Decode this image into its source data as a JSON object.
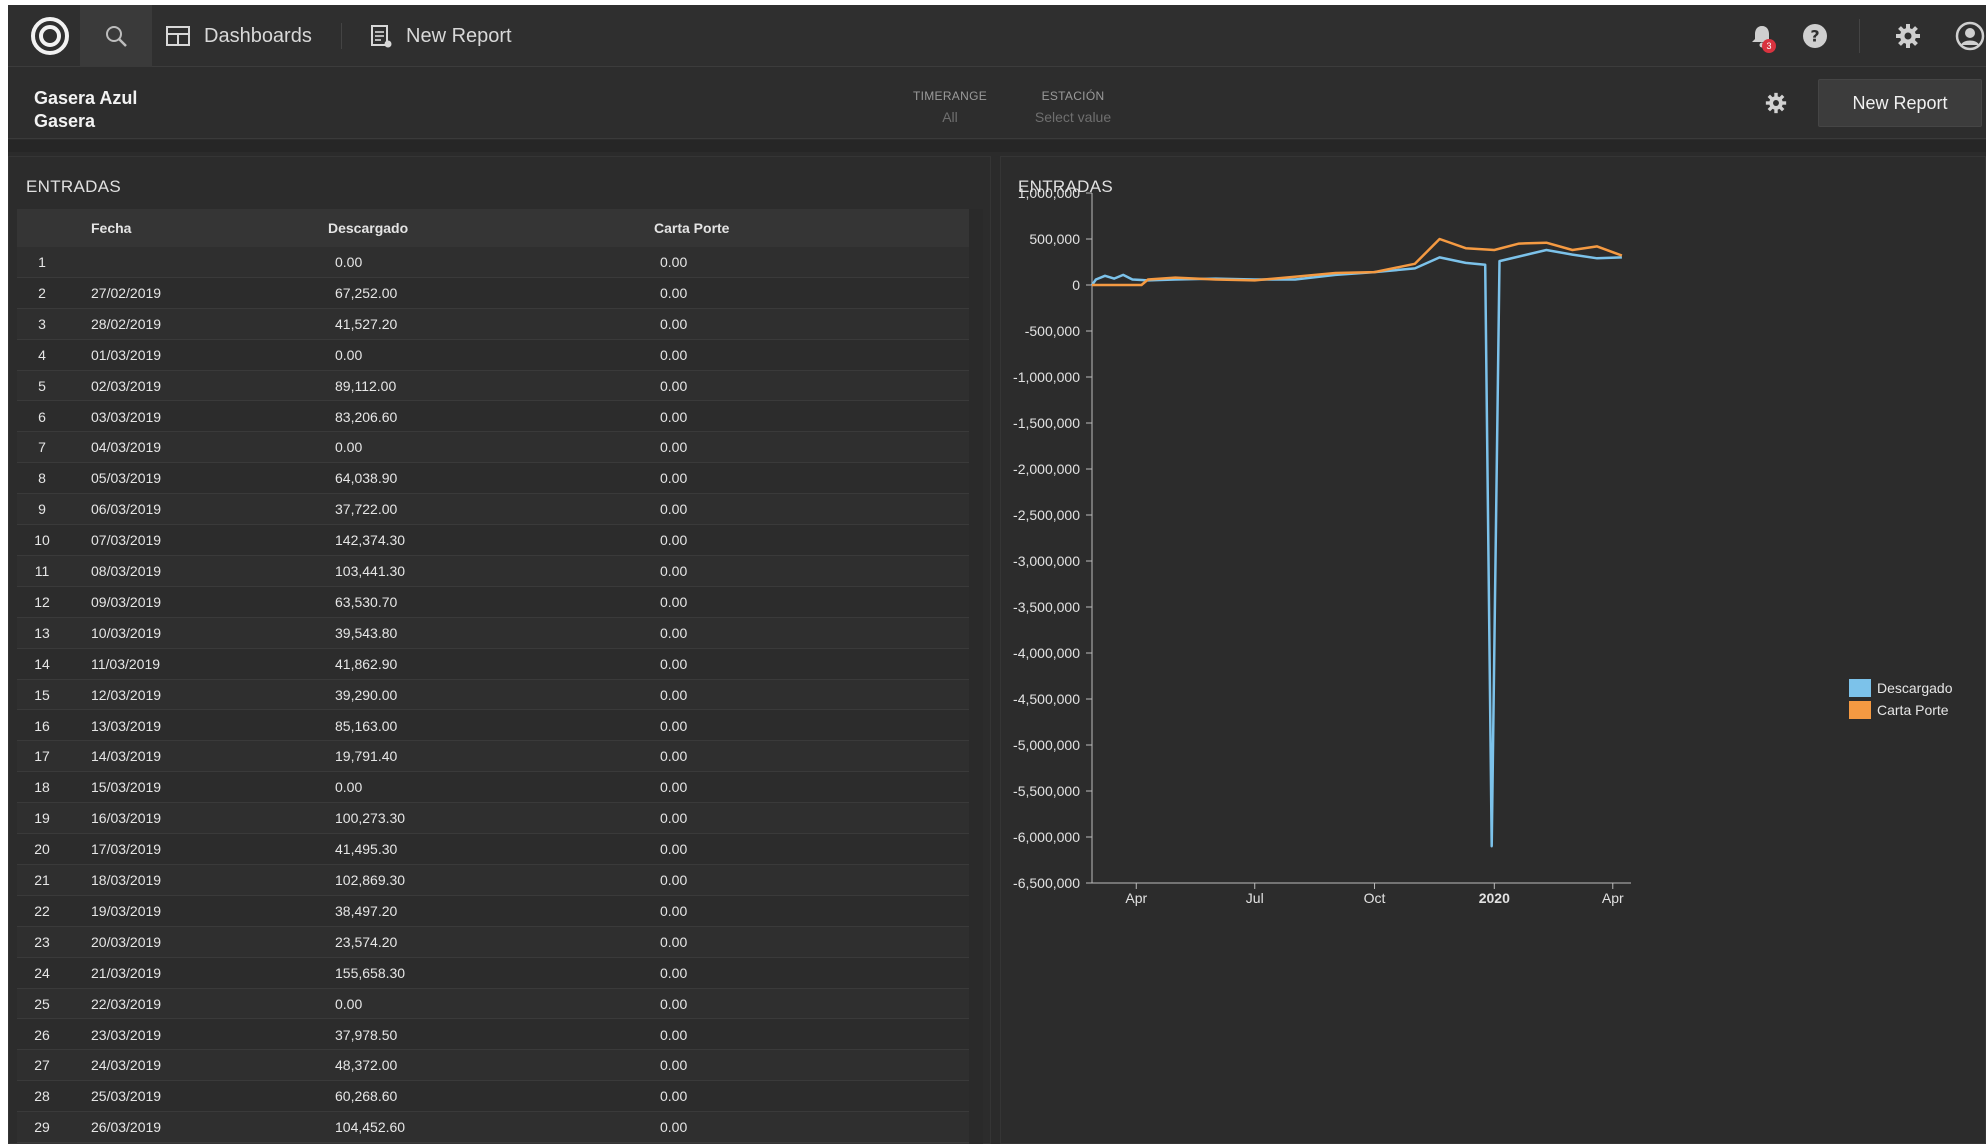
{
  "nav": {
    "dashboards_label": "Dashboards",
    "new_report_label": "New Report",
    "notification_count": "3"
  },
  "dashboard": {
    "title_line1": "Gasera Azul",
    "title_line2": "Gasera",
    "filters": {
      "timerange": {
        "label": "TIMERANGE",
        "value": "All"
      },
      "estacion": {
        "label": "ESTACIÓN",
        "value": "Select value"
      }
    },
    "new_report_button": "New Report"
  },
  "table_panel": {
    "title": "ENTRADAS",
    "columns": [
      "Fecha",
      "Descargado",
      "Carta Porte"
    ],
    "rows": [
      [
        "1",
        "",
        "0.00",
        "0.00"
      ],
      [
        "2",
        "27/02/2019",
        "67,252.00",
        "0.00"
      ],
      [
        "3",
        "28/02/2019",
        "41,527.20",
        "0.00"
      ],
      [
        "4",
        "01/03/2019",
        "0.00",
        "0.00"
      ],
      [
        "5",
        "02/03/2019",
        "89,112.00",
        "0.00"
      ],
      [
        "6",
        "03/03/2019",
        "83,206.60",
        "0.00"
      ],
      [
        "7",
        "04/03/2019",
        "0.00",
        "0.00"
      ],
      [
        "8",
        "05/03/2019",
        "64,038.90",
        "0.00"
      ],
      [
        "9",
        "06/03/2019",
        "37,722.00",
        "0.00"
      ],
      [
        "10",
        "07/03/2019",
        "142,374.30",
        "0.00"
      ],
      [
        "11",
        "08/03/2019",
        "103,441.30",
        "0.00"
      ],
      [
        "12",
        "09/03/2019",
        "63,530.70",
        "0.00"
      ],
      [
        "13",
        "10/03/2019",
        "39,543.80",
        "0.00"
      ],
      [
        "14",
        "11/03/2019",
        "41,862.90",
        "0.00"
      ],
      [
        "15",
        "12/03/2019",
        "39,290.00",
        "0.00"
      ],
      [
        "16",
        "13/03/2019",
        "85,163.00",
        "0.00"
      ],
      [
        "17",
        "14/03/2019",
        "19,791.40",
        "0.00"
      ],
      [
        "18",
        "15/03/2019",
        "0.00",
        "0.00"
      ],
      [
        "19",
        "16/03/2019",
        "100,273.30",
        "0.00"
      ],
      [
        "20",
        "17/03/2019",
        "41,495.30",
        "0.00"
      ],
      [
        "21",
        "18/03/2019",
        "102,869.30",
        "0.00"
      ],
      [
        "22",
        "19/03/2019",
        "38,497.20",
        "0.00"
      ],
      [
        "23",
        "20/03/2019",
        "23,574.20",
        "0.00"
      ],
      [
        "24",
        "21/03/2019",
        "155,658.30",
        "0.00"
      ],
      [
        "25",
        "22/03/2019",
        "0.00",
        "0.00"
      ],
      [
        "26",
        "23/03/2019",
        "37,978.50",
        "0.00"
      ],
      [
        "27",
        "24/03/2019",
        "48,372.00",
        "0.00"
      ],
      [
        "28",
        "25/03/2019",
        "60,268.60",
        "0.00"
      ],
      [
        "29",
        "26/03/2019",
        "104,452.60",
        "0.00"
      ]
    ]
  },
  "chart_panel": {
    "title": "ENTRADAS"
  },
  "chart_data": {
    "type": "line",
    "title": "ENTRADAS",
    "ylim": [
      -6500000,
      1000000
    ],
    "y_ticks": [
      "1,000,000",
      "500,000",
      "0",
      "-500,000",
      "-1,000,000",
      "-1,500,000",
      "-2,000,000",
      "-2,500,000",
      "-3,000,000",
      "-3,500,000",
      "-4,000,000",
      "-4,500,000",
      "-5,000,000",
      "-5,500,000",
      "-6,000,000",
      "-6,500,000"
    ],
    "x_ticks": [
      {
        "label": "Apr",
        "date": "2019-04-01"
      },
      {
        "label": "Jul",
        "date": "2019-07-01"
      },
      {
        "label": "Oct",
        "date": "2019-10-01"
      },
      {
        "label": "2020",
        "date": "2020-01-01"
      },
      {
        "label": "Apr",
        "date": "2020-04-01"
      }
    ],
    "xlim": [
      "2019-02-26",
      "2020-04-15"
    ],
    "legend_position": "right",
    "series": [
      {
        "name": "Descargado",
        "color": "#7cc2ea",
        "points": [
          [
            "2019-02-26",
            0
          ],
          [
            "2019-03-01",
            60000
          ],
          [
            "2019-03-08",
            100000
          ],
          [
            "2019-03-15",
            70000
          ],
          [
            "2019-03-22",
            110000
          ],
          [
            "2019-03-29",
            60000
          ],
          [
            "2019-04-10",
            50000
          ],
          [
            "2019-05-01",
            60000
          ],
          [
            "2019-06-01",
            70000
          ],
          [
            "2019-07-01",
            60000
          ],
          [
            "2019-08-01",
            60000
          ],
          [
            "2019-09-01",
            110000
          ],
          [
            "2019-10-01",
            140000
          ],
          [
            "2019-11-01",
            180000
          ],
          [
            "2019-11-20",
            300000
          ],
          [
            "2019-12-10",
            240000
          ],
          [
            "2019-12-25",
            220000
          ],
          [
            "2019-12-30",
            -6100000
          ],
          [
            "2020-01-05",
            260000
          ],
          [
            "2020-01-20",
            310000
          ],
          [
            "2020-02-10",
            380000
          ],
          [
            "2020-03-01",
            330000
          ],
          [
            "2020-03-20",
            290000
          ],
          [
            "2020-04-08",
            300000
          ]
        ]
      },
      {
        "name": "Carta Porte",
        "color": "#f59a42",
        "points": [
          [
            "2019-02-26",
            0
          ],
          [
            "2019-04-05",
            0
          ],
          [
            "2019-04-10",
            60000
          ],
          [
            "2019-05-01",
            80000
          ],
          [
            "2019-06-01",
            60000
          ],
          [
            "2019-07-01",
            50000
          ],
          [
            "2019-08-01",
            90000
          ],
          [
            "2019-09-01",
            130000
          ],
          [
            "2019-10-01",
            140000
          ],
          [
            "2019-11-01",
            230000
          ],
          [
            "2019-11-20",
            500000
          ],
          [
            "2019-12-10",
            400000
          ],
          [
            "2020-01-01",
            380000
          ],
          [
            "2020-01-20",
            450000
          ],
          [
            "2020-02-10",
            460000
          ],
          [
            "2020-03-01",
            380000
          ],
          [
            "2020-03-20",
            420000
          ],
          [
            "2020-04-08",
            320000
          ]
        ]
      }
    ]
  }
}
